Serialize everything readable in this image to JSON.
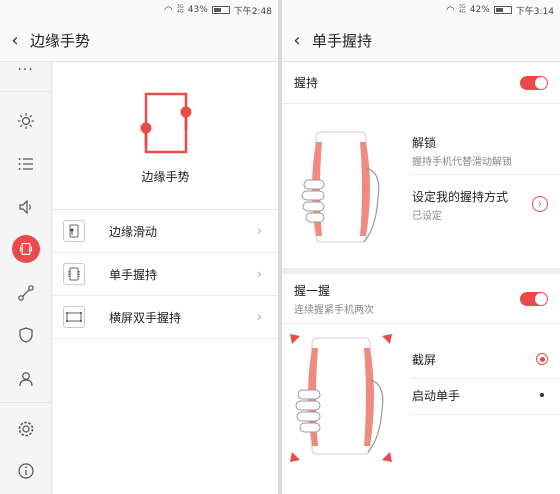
{
  "left": {
    "status": {
      "battery": "43%",
      "time": "下午2:48",
      "signal_top": "3G",
      "signal_bottom": "4G"
    },
    "title": "边缘手势",
    "more": "···",
    "hero_label": "边缘手势",
    "menu": [
      {
        "label": "边缘滑动"
      },
      {
        "label": "单手握持"
      },
      {
        "label": "横屏双手握持"
      }
    ]
  },
  "right": {
    "status": {
      "battery": "42%",
      "time": "下午3:14",
      "signal_top": "3G",
      "signal_bottom": "4G"
    },
    "title": "单手握持",
    "grip": {
      "title": "握持"
    },
    "unlock": {
      "title": "解锁",
      "subtitle": "握持手机代替滑动解锁"
    },
    "method": {
      "title": "设定我的握持方式",
      "subtitle": "已设定"
    },
    "squeeze": {
      "title": "握一握",
      "subtitle": "连续握紧手机两次"
    },
    "screenshot": {
      "label": "截屏"
    },
    "onehand": {
      "label": "启动单手"
    }
  },
  "colors": {
    "accent": "#e94b4b"
  }
}
